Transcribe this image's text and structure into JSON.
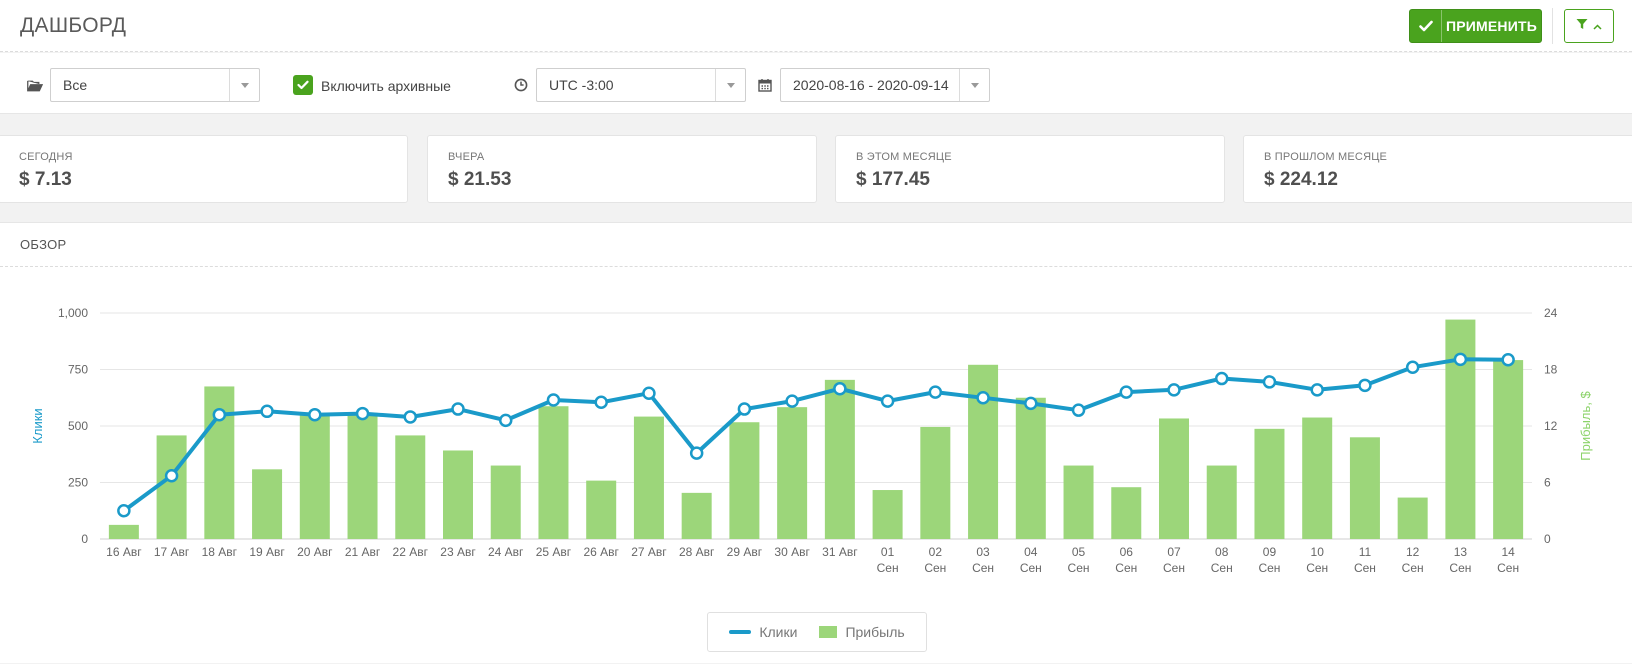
{
  "header": {
    "title": "ДАШБОРД",
    "apply_label": "ПРИМЕНИТЬ"
  },
  "filters": {
    "folder_value": "Все",
    "archive_label": "Включить архивные",
    "timezone_value": "UTC -3:00",
    "date_range_value": "2020-08-16 - 2020-09-14"
  },
  "stats": [
    {
      "caption": "СЕГОДНЯ",
      "value": "$ 7.13"
    },
    {
      "caption": "ВЧЕРА",
      "value": "$ 21.53"
    },
    {
      "caption": "В ЭТОМ МЕСЯЦЕ",
      "value": "$ 177.45"
    },
    {
      "caption": "В ПРОШЛОМ МЕСЯЦЕ",
      "value": "$ 224.12"
    }
  ],
  "overview": {
    "title": "ОБЗОР"
  },
  "colors": {
    "accent": "#4aa31e",
    "line": "#1a9ac9",
    "bar": "#9cd67a"
  },
  "chart_data": {
    "type": "bar",
    "categories": [
      [
        "16 Авг"
      ],
      [
        "17 Авг"
      ],
      [
        "18 Авг"
      ],
      [
        "19 Авг"
      ],
      [
        "20 Авг"
      ],
      [
        "21 Авг"
      ],
      [
        "22 Авг"
      ],
      [
        "23 Авг"
      ],
      [
        "24 Авг"
      ],
      [
        "25 Авг"
      ],
      [
        "26 Авг"
      ],
      [
        "27 Авг"
      ],
      [
        "28 Авг"
      ],
      [
        "29 Авг"
      ],
      [
        "30 Авг"
      ],
      [
        "31 Авг"
      ],
      [
        "01",
        "Сен"
      ],
      [
        "02",
        "Сен"
      ],
      [
        "03",
        "Сен"
      ],
      [
        "04",
        "Сен"
      ],
      [
        "05",
        "Сен"
      ],
      [
        "06",
        "Сен"
      ],
      [
        "07",
        "Сен"
      ],
      [
        "08",
        "Сен"
      ],
      [
        "09",
        "Сен"
      ],
      [
        "10",
        "Сен"
      ],
      [
        "11",
        "Сен"
      ],
      [
        "12",
        "Сен"
      ],
      [
        "13",
        "Сен"
      ],
      [
        "14",
        "Сен"
      ]
    ],
    "series": [
      {
        "name": "Клики",
        "type": "line",
        "axis": "left",
        "values": [
          125,
          280,
          550,
          565,
          550,
          555,
          540,
          575,
          525,
          615,
          605,
          645,
          380,
          575,
          610,
          665,
          610,
          650,
          625,
          600,
          570,
          650,
          660,
          710,
          695,
          660,
          680,
          760,
          795,
          793
        ]
      },
      {
        "name": "Прибыль",
        "type": "bar",
        "axis": "right",
        "values": [
          1.5,
          11,
          16.2,
          7.4,
          13.3,
          13.4,
          11,
          9.4,
          7.8,
          14.1,
          6.2,
          13,
          4.9,
          12.4,
          14,
          16.9,
          5.2,
          11.9,
          18.5,
          15,
          7.8,
          5.5,
          12.8,
          7.8,
          11.7,
          12.9,
          10.8,
          4.4,
          23.3,
          19
        ]
      }
    ],
    "y_left": {
      "label": "Клики",
      "min": 0,
      "max": 1000,
      "ticks": [
        "0",
        "250",
        "500",
        "750",
        "1,000"
      ]
    },
    "y_right": {
      "label": "Прибыль, $",
      "min": 0,
      "max": 24,
      "ticks": [
        "0",
        "6",
        "12",
        "18",
        "24"
      ]
    },
    "grid": true,
    "legend": "bottom-center"
  }
}
